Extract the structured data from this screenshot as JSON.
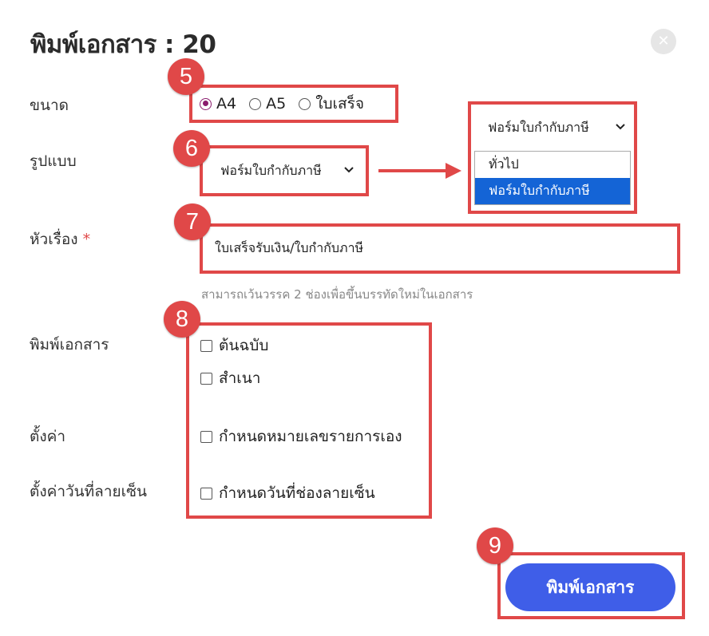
{
  "dialog": {
    "title": "พิมพ์เอกสาร : 20",
    "close_icon": "close-icon"
  },
  "form": {
    "size": {
      "label": "ขนาด",
      "options": [
        "A4",
        "A5",
        "ใบเสร็จ"
      ],
      "selected": "A4"
    },
    "format": {
      "label": "รูปแบบ",
      "value": "ฟอร์มใบกำกับภาษี",
      "dropdown_value": "ฟอร์มใบกำกับภาษี",
      "options": [
        "ทั่วไป",
        "ฟอร์มใบกำกับภาษี"
      ]
    },
    "subject": {
      "label": "หัวเรื่อง",
      "required_mark": "*",
      "value": "ใบเสร็จรับเงิน/ใบกำกับภาษี",
      "helper": "สามารถเว้นวรรค 2 ช่องเพื่อขึ้นบรรทัดใหม่ในเอกสาร"
    },
    "print_docs": {
      "label": "พิมพ์เอกสาร",
      "options": [
        "ต้นฉบับ",
        "สำเนา"
      ]
    },
    "settings": {
      "label": "ตั้งค่า",
      "option": "กำหนดหมายเลขรายการเอง"
    },
    "signature_date": {
      "label": "ตั้งค่าวันที่ลายเซ็น",
      "option": "กำหนดวันที่ช่องลายเซ็น"
    }
  },
  "badges": [
    "5",
    "6",
    "7",
    "8",
    "9"
  ],
  "actions": {
    "print_label": "พิมพ์เอกสาร"
  },
  "colors": {
    "highlight": "#e04848",
    "primary_button": "#3f5ee8",
    "radio_checked": "#8a1b6d",
    "dropdown_selected": "#1464d6"
  }
}
